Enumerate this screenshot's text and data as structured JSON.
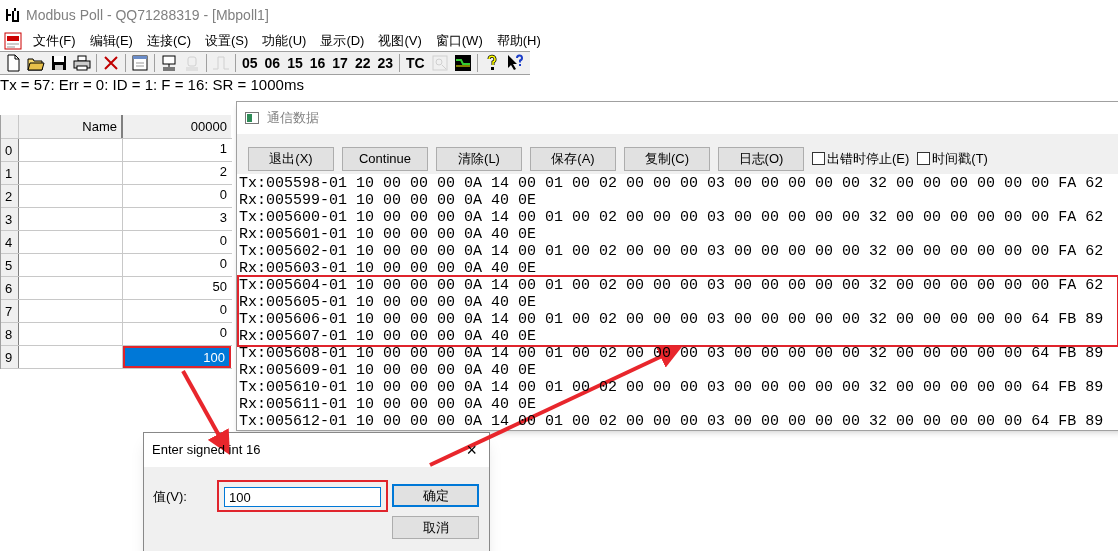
{
  "window": {
    "title": "Modbus Poll - QQ71288319 - [Mbpoll1]"
  },
  "menu": [
    "文件(F)",
    "编辑(E)",
    "连接(C)",
    "设置(S)",
    "功能(U)",
    "显示(D)",
    "视图(V)",
    "窗口(W)",
    "帮助(H)"
  ],
  "toolbar": [
    {
      "kind": "new",
      "disabled": false
    },
    {
      "kind": "open",
      "disabled": false
    },
    {
      "kind": "save",
      "disabled": false
    },
    {
      "kind": "print",
      "disabled": false
    },
    {
      "kind": "sep"
    },
    {
      "kind": "delete",
      "disabled": false
    },
    {
      "kind": "sep"
    },
    {
      "kind": "window",
      "disabled": false
    },
    {
      "kind": "sep"
    },
    {
      "kind": "connect",
      "disabled": false
    },
    {
      "kind": "disconnect",
      "disabled": true
    },
    {
      "kind": "sep"
    },
    {
      "kind": "pulse",
      "disabled": true
    },
    {
      "kind": "sep"
    },
    {
      "kind": "text",
      "label": "05",
      "disabled": false
    },
    {
      "kind": "text",
      "label": "06",
      "disabled": false
    },
    {
      "kind": "text",
      "label": "15",
      "disabled": false
    },
    {
      "kind": "text",
      "label": "16",
      "disabled": false
    },
    {
      "kind": "text",
      "label": "17",
      "disabled": false
    },
    {
      "kind": "text",
      "label": "22",
      "disabled": false
    },
    {
      "kind": "text",
      "label": "23",
      "disabled": false
    },
    {
      "kind": "sep"
    },
    {
      "kind": "text",
      "label": "TC",
      "disabled": false
    },
    {
      "kind": "picture-tool",
      "disabled": true
    },
    {
      "kind": "chart",
      "disabled": false
    },
    {
      "kind": "sep"
    },
    {
      "kind": "help",
      "disabled": false
    },
    {
      "kind": "context-help",
      "disabled": false
    }
  ],
  "status_line": "Tx = 57: Err = 0: ID = 1: F = 16: SR = 1000ms",
  "table": {
    "columns": [
      "Name",
      "00000"
    ],
    "rows": [
      {
        "index": "0",
        "name": "",
        "value": "1",
        "selected": false
      },
      {
        "index": "1",
        "name": "",
        "value": "2",
        "selected": false
      },
      {
        "index": "2",
        "name": "",
        "value": "0",
        "selected": false
      },
      {
        "index": "3",
        "name": "",
        "value": "3",
        "selected": false
      },
      {
        "index": "4",
        "name": "",
        "value": "0",
        "selected": false
      },
      {
        "index": "5",
        "name": "",
        "value": "0",
        "selected": false
      },
      {
        "index": "6",
        "name": "",
        "value": "50",
        "selected": false
      },
      {
        "index": "7",
        "name": "",
        "value": "0",
        "selected": false
      },
      {
        "index": "8",
        "name": "",
        "value": "0",
        "selected": false
      },
      {
        "index": "9",
        "name": "",
        "value": "100",
        "selected": true
      }
    ]
  },
  "comm_window": {
    "title": "通信数据",
    "buttons": [
      "退出(X)",
      "Continue",
      "清除(L)",
      "保存(A)",
      "复制(C)",
      "日志(O)"
    ],
    "checkboxes": [
      {
        "label": "出错时停止(E)",
        "checked": false
      },
      {
        "label": "时间戳(T)",
        "checked": false
      }
    ],
    "log": [
      {
        "text": "Tx:005598-01 10 00 00 00 0A 14 00 01 00 02 00 00 00 03 00 00 00 00 00 32 00 00 00 00 00 00 FA 62",
        "highlighted": false
      },
      {
        "text": "Rx:005599-01 10 00 00 00 0A 40 0E",
        "highlighted": false
      },
      {
        "text": "Tx:005600-01 10 00 00 00 0A 14 00 01 00 02 00 00 00 03 00 00 00 00 00 32 00 00 00 00 00 00 FA 62",
        "highlighted": false
      },
      {
        "text": "Rx:005601-01 10 00 00 00 0A 40 0E",
        "highlighted": false
      },
      {
        "text": "Tx:005602-01 10 00 00 00 0A 14 00 01 00 02 00 00 00 03 00 00 00 00 00 32 00 00 00 00 00 00 FA 62",
        "highlighted": false
      },
      {
        "text": "Rx:005603-01 10 00 00 00 0A 40 0E",
        "highlighted": false
      },
      {
        "text": "Tx:005604-01 10 00 00 00 0A 14 00 01 00 02 00 00 00 03 00 00 00 00 00 32 00 00 00 00 00 00 FA 62",
        "highlighted": true
      },
      {
        "text": "Rx:005605-01 10 00 00 00 0A 40 0E",
        "highlighted": true
      },
      {
        "text": "Tx:005606-01 10 00 00 00 0A 14 00 01 00 02 00 00 00 03 00 00 00 00 00 32 00 00 00 00 00 64 FB 89",
        "highlighted": true
      },
      {
        "text": "Rx:005607-01 10 00 00 00 0A 40 0E",
        "highlighted": true
      },
      {
        "text": "Tx:005608-01 10 00 00 00 0A 14 00 01 00 02 00 00 00 03 00 00 00 00 00 32 00 00 00 00 00 64 FB 89",
        "highlighted": false
      },
      {
        "text": "Rx:005609-01 10 00 00 00 0A 40 0E",
        "highlighted": false
      },
      {
        "text": "Tx:005610-01 10 00 00 00 0A 14 00 01 00 02 00 00 00 03 00 00 00 00 00 32 00 00 00 00 00 64 FB 89",
        "highlighted": false
      },
      {
        "text": "Rx:005611-01 10 00 00 00 0A 40 0E",
        "highlighted": false
      },
      {
        "text": "Tx:005612-01 10 00 00 00 0A 14 00 01 00 02 00 00 00 03 00 00 00 00 00 32 00 00 00 00 00 64 FB 89",
        "highlighted": false
      }
    ]
  },
  "dialog": {
    "title": "Enter signed int 16",
    "close": "×",
    "label": "值(V):",
    "value": "100",
    "highlighted": true,
    "buttons": [
      {
        "label": "确定",
        "default": true
      },
      {
        "label": "取消",
        "default": false
      }
    ]
  }
}
